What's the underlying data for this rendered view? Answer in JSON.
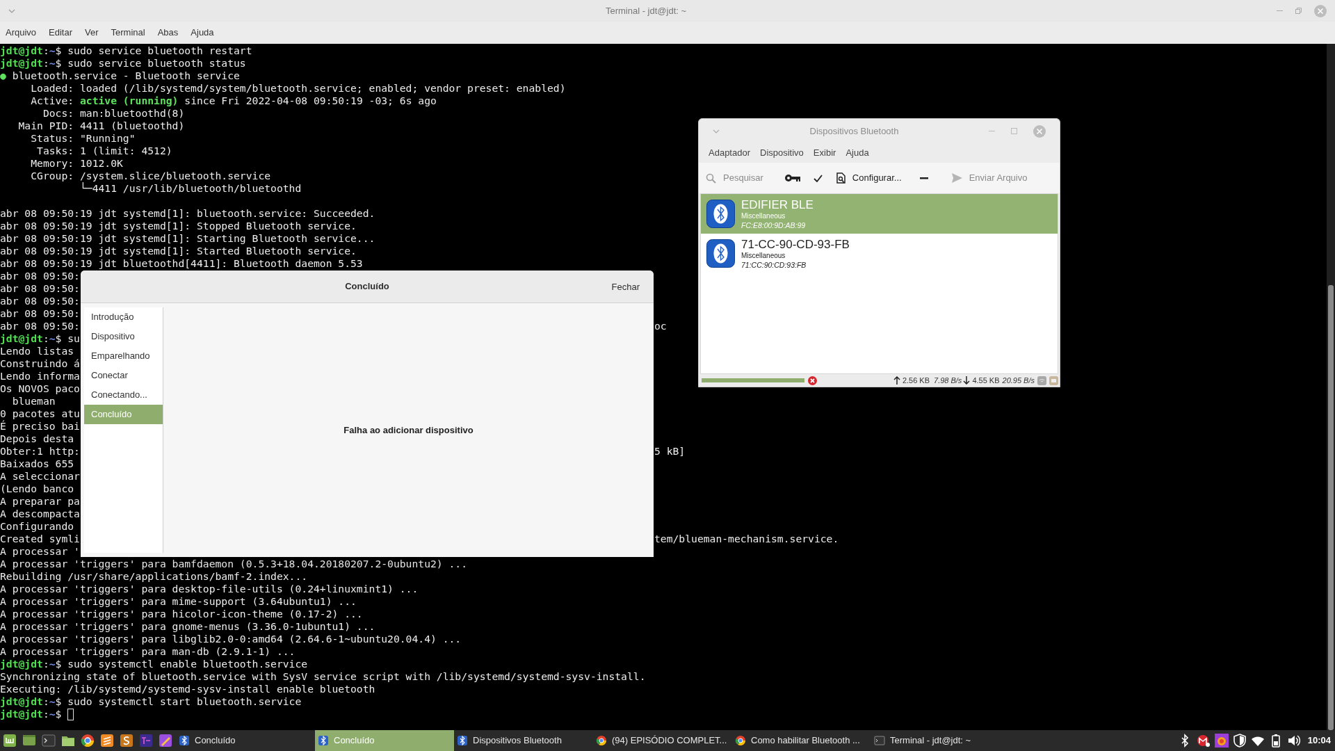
{
  "terminal_window": {
    "title": "Terminal - jdt@jdt: ~",
    "menu": [
      "Arquivo",
      "Editar",
      "Ver",
      "Terminal",
      "Abas",
      "Ajuda"
    ],
    "lines": [
      {
        "kind": "text",
        "parts": [
          {
            "text": "jdt@jdt",
            "kind": "user"
          },
          {
            "text": ":",
            "kind": "plain"
          },
          {
            "text": "~",
            "kind": "path"
          },
          {
            "text": "$ sudo service bluetooth restart",
            "kind": "plain"
          }
        ]
      },
      {
        "kind": "text",
        "parts": [
          {
            "text": "jdt@jdt",
            "kind": "user"
          },
          {
            "text": ":",
            "kind": "plain"
          },
          {
            "text": "~",
            "kind": "path"
          },
          {
            "text": "$ sudo service bluetooth status",
            "kind": "plain"
          }
        ]
      },
      {
        "kind": "text",
        "parts": [
          {
            "text": "●",
            "kind": "bullet"
          },
          {
            "text": " bluetooth.service - Bluetooth service",
            "kind": "plain"
          }
        ]
      },
      {
        "kind": "text",
        "parts": [
          {
            "text": "     Loaded: loaded (/lib/systemd/system/bluetooth.service; enabled; vendor preset: enabled)",
            "kind": "plain"
          }
        ]
      },
      {
        "kind": "text",
        "parts": [
          {
            "text": "     Active: ",
            "kind": "plain"
          },
          {
            "text": "active (running)",
            "kind": "ok"
          },
          {
            "text": " since Fri 2022-04-08 09:50:19 -03; 6s ago",
            "kind": "plain"
          }
        ]
      },
      {
        "kind": "text",
        "parts": [
          {
            "text": "       Docs: man:bluetoothd(8)",
            "kind": "plain"
          }
        ]
      },
      {
        "kind": "text",
        "parts": [
          {
            "text": "   Main PID: 4411 (bluetoothd)",
            "kind": "plain"
          }
        ]
      },
      {
        "kind": "text",
        "parts": [
          {
            "text": "     Status: \"Running\"",
            "kind": "plain"
          }
        ]
      },
      {
        "kind": "text",
        "parts": [
          {
            "text": "      Tasks: 1 (limit: 4512)",
            "kind": "plain"
          }
        ]
      },
      {
        "kind": "text",
        "parts": [
          {
            "text": "     Memory: 1012.0K",
            "kind": "plain"
          }
        ]
      },
      {
        "kind": "text",
        "parts": [
          {
            "text": "     CGroup: /system.slice/bluetooth.service",
            "kind": "plain"
          }
        ]
      },
      {
        "kind": "text",
        "parts": [
          {
            "text": "             └─4411 /usr/lib/bluetooth/bluetoothd",
            "kind": "plain"
          }
        ]
      },
      {
        "kind": "blank"
      },
      {
        "kind": "text",
        "parts": [
          {
            "text": "abr 08 09:50:19 jdt systemd[1]: bluetooth.service: Succeeded.",
            "kind": "plain"
          }
        ]
      },
      {
        "kind": "text",
        "parts": [
          {
            "text": "abr 08 09:50:19 jdt systemd[1]: Stopped Bluetooth service.",
            "kind": "plain"
          }
        ]
      },
      {
        "kind": "text",
        "parts": [
          {
            "text": "abr 08 09:50:19 jdt systemd[1]: Starting Bluetooth service...",
            "kind": "plain"
          }
        ]
      },
      {
        "kind": "text",
        "parts": [
          {
            "text": "abr 08 09:50:19 jdt systemd[1]: Started Bluetooth service.",
            "kind": "plain"
          }
        ]
      },
      {
        "kind": "text",
        "parts": [
          {
            "text": "abr 08 09:50:19 jdt bluetoothd[4411]: Bluetooth daemon 5.53",
            "kind": "plain"
          }
        ]
      },
      {
        "kind": "text",
        "parts": [
          {
            "text": "abr 08 09:50:",
            "kind": "plain"
          }
        ]
      },
      {
        "kind": "text",
        "parts": [
          {
            "text": "abr 08 09:50:",
            "kind": "plain"
          }
        ]
      },
      {
        "kind": "text",
        "parts": [
          {
            "text": "abr 08 09:50:",
            "kind": "plain"
          }
        ]
      },
      {
        "kind": "text",
        "parts": [
          {
            "text": "abr 08 09:50:",
            "kind": "plain"
          }
        ]
      },
      {
        "kind": "text",
        "parts": [
          {
            "text": "abr 08 09:50:",
            "kind": "plain"
          }
        ],
        "right": "oc"
      },
      {
        "kind": "text",
        "parts": [
          {
            "text": "jdt@jdt",
            "kind": "user"
          },
          {
            "text": ":",
            "kind": "plain"
          },
          {
            "text": "~",
            "kind": "path"
          },
          {
            "text": "$ su",
            "kind": "plain"
          }
        ]
      },
      {
        "kind": "text",
        "parts": [
          {
            "text": "Lendo listas",
            "kind": "plain"
          }
        ]
      },
      {
        "kind": "text",
        "parts": [
          {
            "text": "Construindo á",
            "kind": "plain"
          }
        ]
      },
      {
        "kind": "text",
        "parts": [
          {
            "text": "Lendo informa",
            "kind": "plain"
          }
        ]
      },
      {
        "kind": "text",
        "parts": [
          {
            "text": "Os NOVOS paco",
            "kind": "plain"
          }
        ]
      },
      {
        "kind": "text",
        "parts": [
          {
            "text": "  blueman",
            "kind": "plain"
          }
        ]
      },
      {
        "kind": "text",
        "parts": [
          {
            "text": "0 pacotes atu",
            "kind": "plain"
          }
        ]
      },
      {
        "kind": "text",
        "parts": [
          {
            "text": "É preciso bai",
            "kind": "plain"
          }
        ]
      },
      {
        "kind": "text",
        "parts": [
          {
            "text": "Depois desta",
            "kind": "plain"
          }
        ]
      },
      {
        "kind": "text",
        "parts": [
          {
            "text": "Obter:1 http:",
            "kind": "plain"
          }
        ],
        "right": "5 kB]"
      },
      {
        "kind": "text",
        "parts": [
          {
            "text": "Baixados 655",
            "kind": "plain"
          }
        ]
      },
      {
        "kind": "text",
        "parts": [
          {
            "text": "A seleccionar",
            "kind": "plain"
          }
        ]
      },
      {
        "kind": "text",
        "parts": [
          {
            "text": "(Lendo banco",
            "kind": "plain"
          }
        ]
      },
      {
        "kind": "text",
        "parts": [
          {
            "text": "A preparar pa",
            "kind": "plain"
          }
        ]
      },
      {
        "kind": "text",
        "parts": [
          {
            "text": "A descompacta",
            "kind": "plain"
          }
        ]
      },
      {
        "kind": "text",
        "parts": [
          {
            "text": "Configurando",
            "kind": "plain"
          }
        ]
      },
      {
        "kind": "text",
        "parts": [
          {
            "text": "Created symli",
            "kind": "plain"
          }
        ],
        "right": "tem/blueman-mechanism.service."
      },
      {
        "kind": "text",
        "parts": [
          {
            "text": "A processar '",
            "kind": "plain"
          }
        ]
      },
      {
        "kind": "text",
        "parts": [
          {
            "text": "A processar 'triggers' para bamfdaemon (0.5.3+18.04.20180207.2-0ubuntu2) ...",
            "kind": "plain"
          }
        ]
      },
      {
        "kind": "text",
        "parts": [
          {
            "text": "Rebuilding /usr/share/applications/bamf-2.index...",
            "kind": "plain"
          }
        ]
      },
      {
        "kind": "text",
        "parts": [
          {
            "text": "A processar 'triggers' para desktop-file-utils (0.24+linuxmint1) ...",
            "kind": "plain"
          }
        ]
      },
      {
        "kind": "text",
        "parts": [
          {
            "text": "A processar 'triggers' para mime-support (3.64ubuntu1) ...",
            "kind": "plain"
          }
        ]
      },
      {
        "kind": "text",
        "parts": [
          {
            "text": "A processar 'triggers' para hicolor-icon-theme (0.17-2) ...",
            "kind": "plain"
          }
        ]
      },
      {
        "kind": "text",
        "parts": [
          {
            "text": "A processar 'triggers' para gnome-menus (3.36.0-1ubuntu1) ...",
            "kind": "plain"
          }
        ]
      },
      {
        "kind": "text",
        "parts": [
          {
            "text": "A processar 'triggers' para libglib2.0-0:amd64 (2.64.6-1~ubuntu20.04.4) ...",
            "kind": "plain"
          }
        ]
      },
      {
        "kind": "text",
        "parts": [
          {
            "text": "A processar 'triggers' para man-db (2.9.1-1) ...",
            "kind": "plain"
          }
        ]
      },
      {
        "kind": "text",
        "parts": [
          {
            "text": "jdt@jdt",
            "kind": "user"
          },
          {
            "text": ":",
            "kind": "plain"
          },
          {
            "text": "~",
            "kind": "path"
          },
          {
            "text": "$ sudo systemctl enable bluetooth.service",
            "kind": "plain"
          }
        ]
      },
      {
        "kind": "text",
        "parts": [
          {
            "text": "Synchronizing state of bluetooth.service with SysV service script with /lib/systemd/systemd-sysv-install.",
            "kind": "plain"
          }
        ]
      },
      {
        "kind": "text",
        "parts": [
          {
            "text": "Executing: /lib/systemd/systemd-sysv-install enable bluetooth",
            "kind": "plain"
          }
        ]
      },
      {
        "kind": "text",
        "parts": [
          {
            "text": "jdt@jdt",
            "kind": "user"
          },
          {
            "text": ":",
            "kind": "plain"
          },
          {
            "text": "~",
            "kind": "path"
          },
          {
            "text": "$ sudo systemctl start bluetooth.service",
            "kind": "plain"
          }
        ]
      },
      {
        "kind": "text",
        "parts": [
          {
            "text": "jdt@jdt",
            "kind": "user"
          },
          {
            "text": ":",
            "kind": "plain"
          },
          {
            "text": "~",
            "kind": "path"
          },
          {
            "text": "$ ",
            "kind": "plain"
          }
        ],
        "cursor": true
      }
    ]
  },
  "wizard_dialog": {
    "title": "Concluído",
    "close_button": "Fechar",
    "message": "Falha ao adicionar dispositivo",
    "steps": [
      {
        "label": "Introdução",
        "selected": false
      },
      {
        "label": "Dispositivo",
        "selected": false
      },
      {
        "label": "Emparelhando",
        "selected": false
      },
      {
        "label": "Conectar",
        "selected": false
      },
      {
        "label": "Conectando...",
        "selected": false
      },
      {
        "label": "Concluído",
        "selected": true
      }
    ]
  },
  "bluetooth_window": {
    "title": "Dispositivos Bluetooth",
    "menu": [
      "Adaptador",
      "Dispositivo",
      "Exibir",
      "Ajuda"
    ],
    "toolbar": [
      {
        "kind": "search",
        "label": "Pesquisar",
        "disabled": true
      },
      {
        "kind": "key",
        "disabled": false
      },
      {
        "kind": "check",
        "disabled": false
      },
      {
        "kind": "document",
        "label": "Configurar...",
        "disabled": false
      },
      {
        "kind": "minus",
        "disabled": false
      },
      {
        "kind": "send",
        "label": "Enviar Arquivo",
        "disabled": true
      }
    ],
    "devices": [
      {
        "name": "EDIFIER BLE",
        "type": "Miscellaneous",
        "address": "FC:E8:00:9D:AB:99",
        "selected": true
      },
      {
        "name": "71-CC-90-CD-93-FB",
        "type": "Miscellaneous",
        "address": "71:CC:90:CD:93:FB",
        "selected": false
      }
    ],
    "status_bar": {
      "progress": {
        "level": 1
      },
      "upload_total": "2.56 KB",
      "upload_rate": "7.98 B/s",
      "download_total": "4.55 KB",
      "download_rate": "20.95 B/s"
    }
  },
  "taskbar": {
    "launchers": [
      {
        "kind": "menu"
      },
      {
        "kind": "desktop"
      },
      {
        "kind": "terminal"
      },
      {
        "kind": "folder"
      },
      {
        "kind": "browser"
      },
      {
        "kind": "editor"
      },
      {
        "kind": "app-s"
      },
      {
        "kind": "app-tex"
      },
      {
        "kind": "pencil"
      }
    ],
    "tasks": [
      {
        "label": "Concluído",
        "kind": "bluetooth",
        "selected": false
      },
      {
        "label": "Concluído",
        "kind": "bluetooth",
        "selected": true
      },
      {
        "label": "Dispositivos Bluetooth",
        "kind": "bluetooth",
        "selected": false
      },
      {
        "label": "(94) EPISÓDIO COMPLET...",
        "kind": "browser",
        "selected": false
      },
      {
        "label": "Como habilitar Bluetooth ...",
        "kind": "browser",
        "selected": false
      },
      {
        "label": "Terminal - jdt@jdt: ~",
        "kind": "terminal",
        "selected": false
      }
    ],
    "tray": [
      {
        "kind": "bluetooth"
      },
      {
        "kind": "mail"
      },
      {
        "kind": "app"
      },
      {
        "kind": "shield"
      },
      {
        "kind": "wifi"
      },
      {
        "kind": "battery"
      },
      {
        "kind": "volume"
      }
    ],
    "clock": "10:04"
  }
}
